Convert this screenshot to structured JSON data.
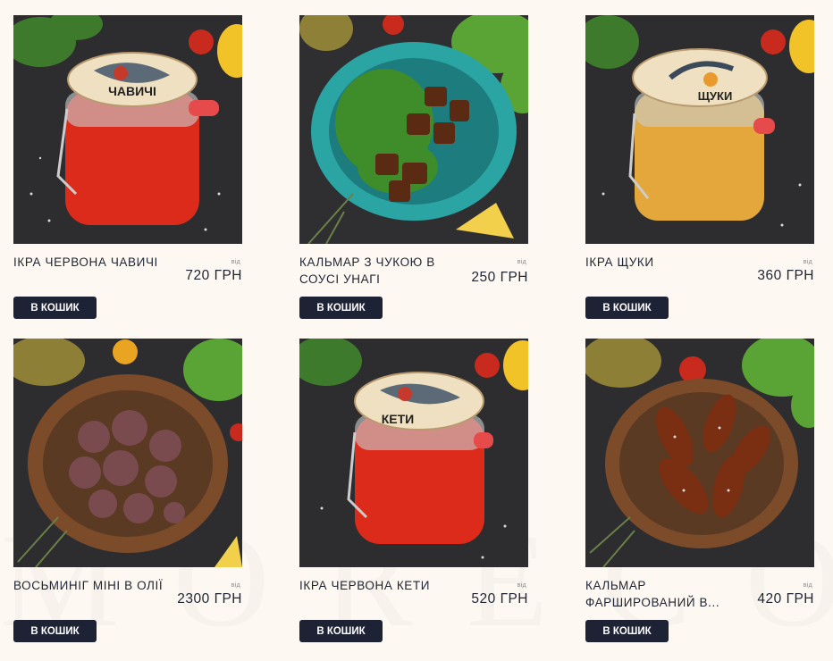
{
  "watermark": "MORECOLL",
  "products": [
    {
      "title": "ІКРА ЧЕРВОНА ЧАВИЧІ",
      "from": "від",
      "price": "720 ГРН",
      "button": "В КОШИК",
      "image": "red-caviar-jar",
      "jar_label": "ЧАВИЧІ"
    },
    {
      "title": "КАЛЬМАР З ЧУКОЮ В СОУСІ УНАГІ",
      "from": "від",
      "price": "250 ГРН",
      "button": "В КОШИК",
      "image": "squid-seaweed-bowl"
    },
    {
      "title": "ІКРА ЩУКИ",
      "from": "від",
      "price": "360 ГРН",
      "button": "В КОШИК",
      "image": "pike-caviar-jar",
      "jar_label": "ЩУКИ"
    },
    {
      "title": "ВОСЬМИНІГ МІНІ В ОЛІЇ",
      "from": "від",
      "price": "2300 ГРН",
      "button": "В КОШИК",
      "image": "mini-octopus-bowl"
    },
    {
      "title": "ІКРА ЧЕРВОНА КЕТИ",
      "from": "від",
      "price": "520 ГРН",
      "button": "В КОШИК",
      "image": "red-caviar-jar",
      "jar_label": "КЕТИ"
    },
    {
      "title": "КАЛЬМАР ФАРШИРОВАНИЙ В...",
      "from": "від",
      "price": "420 ГРН",
      "button": "В КОШИК",
      "image": "stuffed-squid-bowl"
    }
  ]
}
